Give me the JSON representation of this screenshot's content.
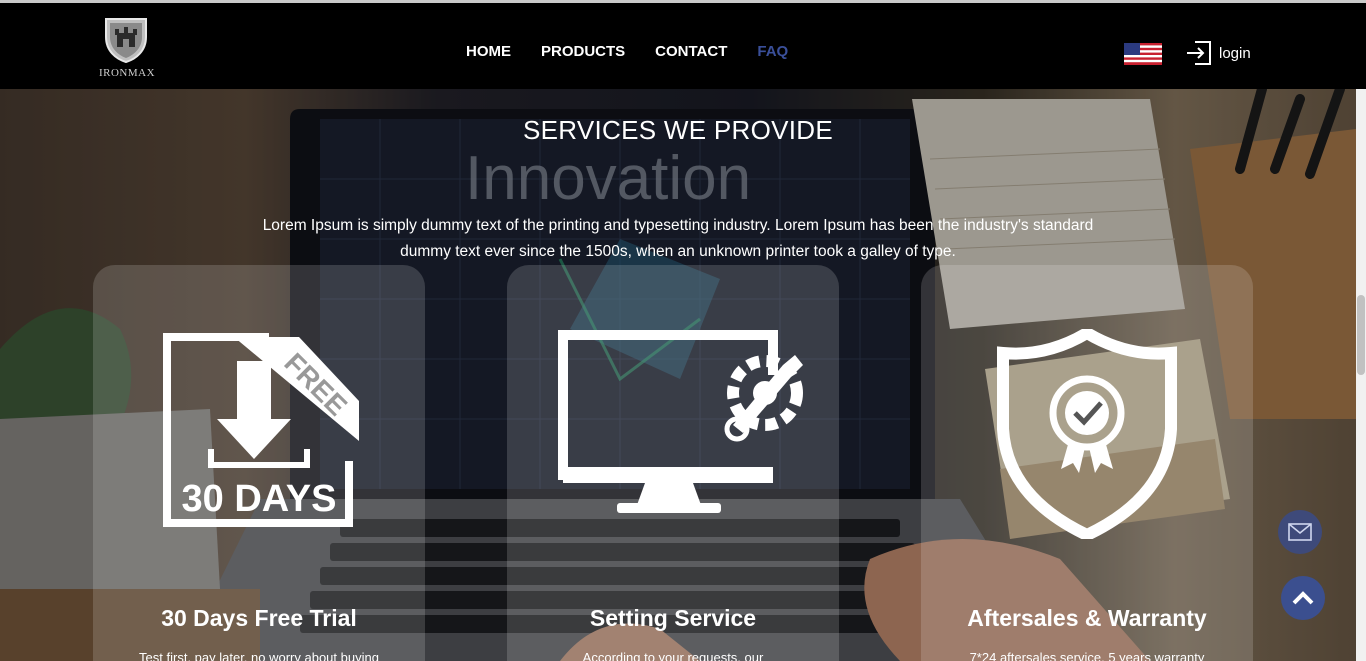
{
  "header": {
    "logo_text": "IRONMAX",
    "nav": [
      {
        "label": "HOME",
        "active": false
      },
      {
        "label": "PRODUCTS",
        "active": false
      },
      {
        "label": "CONTACT",
        "active": false
      },
      {
        "label": "FAQ",
        "active": true
      }
    ],
    "language_icon": "us-flag-icon",
    "login_label": "login"
  },
  "section": {
    "title": "SERVICES WE PROVIDE",
    "description": "Lorem Ipsum is simply dummy text of the printing and typesetting industry. Lorem Ipsum has been the industry's standard dummy text ever since the 1500s, when an unknown printer took a galley of type."
  },
  "cards": [
    {
      "icon": "free-30-days-download-icon",
      "icon_badge": "FREE",
      "icon_caption": "30 DAYS",
      "title": "30 Days Free Trial",
      "text": "Test first, pay later, no worry about buying"
    },
    {
      "icon": "monitor-settings-icon",
      "title": "Setting Service",
      "text": "According to your requests, our"
    },
    {
      "icon": "shield-award-icon",
      "title": "Aftersales & Warranty",
      "text": "7*24 aftersales service, 5 years warranty"
    }
  ],
  "floating": {
    "mail_icon": "mail-icon",
    "top_icon": "chevron-up-icon"
  },
  "colors": {
    "header_bg": "#000000",
    "active_nav": "#3a4f9a",
    "fab": "#3b4f8f"
  }
}
